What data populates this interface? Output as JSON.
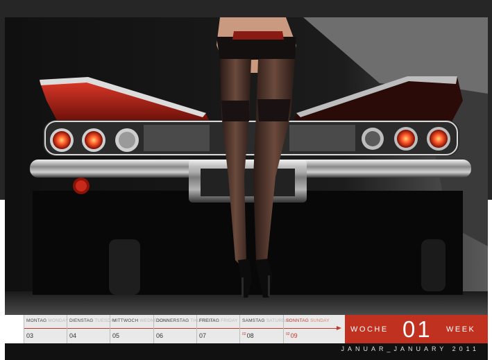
{
  "calendar": {
    "days": [
      {
        "de": "MONTAG",
        "en": "MONDAY",
        "num": "03",
        "mark": ""
      },
      {
        "de": "DIENSTAG",
        "en": "TUESDAY",
        "num": "04",
        "mark": ""
      },
      {
        "de": "MITTWOCH",
        "en": "WEDNESDAY",
        "num": "05",
        "mark": ""
      },
      {
        "de": "DONNERSTAG",
        "en": "THURSDAY",
        "num": "06",
        "mark": ""
      },
      {
        "de": "FREITAG",
        "en": "FRIDAY",
        "num": "07",
        "mark": ""
      },
      {
        "de": "SAMSTAG",
        "en": "SATURDAY",
        "num": "08",
        "mark": "02"
      },
      {
        "de": "SONNTAG",
        "en": "SUNDAY",
        "num": "09",
        "mark": "02"
      }
    ],
    "week_label_de": "WOCHE",
    "week_number": "01",
    "week_label_en": "WEEK",
    "month_line": "JANUAR_JANUARY  2011"
  },
  "colors": {
    "accent": "#c0321f",
    "strip": "#e9e9e9",
    "background": "#111111"
  }
}
